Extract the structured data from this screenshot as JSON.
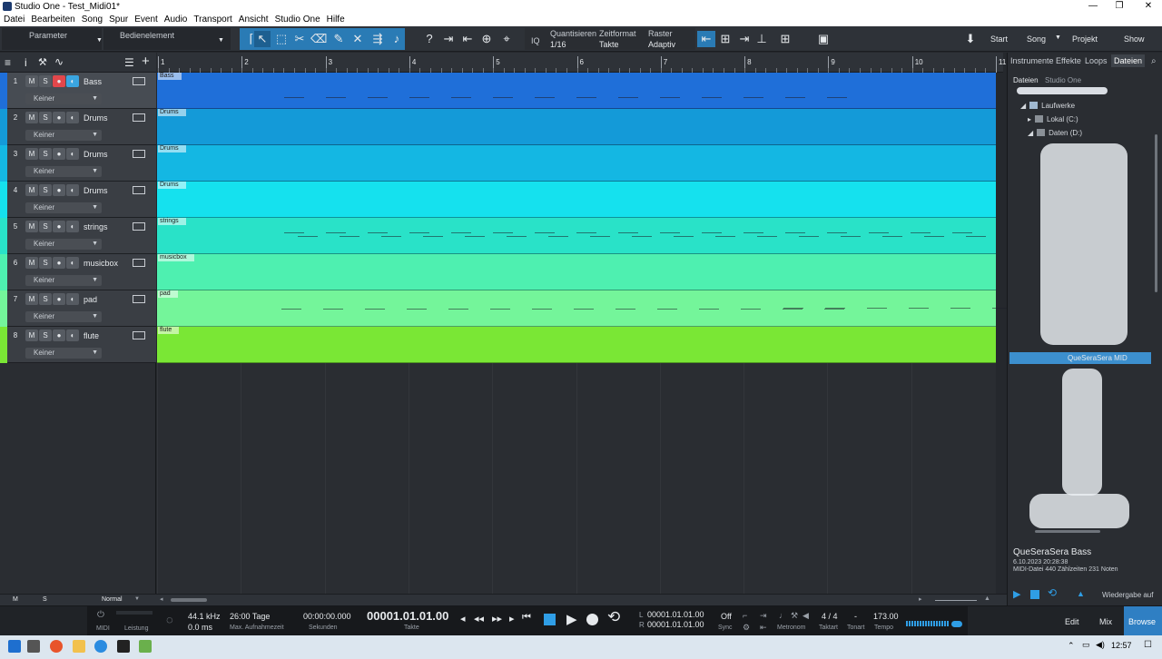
{
  "window": {
    "title": "Studio One - Test_Midi01*",
    "minimize": "—",
    "restore": "❐",
    "close": "✕"
  },
  "menu": [
    "Datei",
    "Bearbeiten",
    "Song",
    "Spur",
    "Event",
    "Audio",
    "Transport",
    "Ansicht",
    "Studio One",
    "Hilfe"
  ],
  "toolbar": {
    "parameter_label": "Parameter",
    "control_label": "Bedienelement",
    "iq_label": "IQ",
    "quantize_label": "Quantisieren",
    "quantize_value": "1/16",
    "timeformat_label": "Zeitformat",
    "timeformat_value": "Takte",
    "grid_label": "Raster",
    "grid_value": "Adaptiv",
    "start_label": "Start",
    "song_label": "Song",
    "project_label": "Projekt",
    "show_label": "Show"
  },
  "ruler": {
    "bars": [
      "1",
      "2",
      "3",
      "4",
      "5",
      "6",
      "7",
      "8",
      "9",
      "10",
      "11"
    ]
  },
  "tracks": [
    {
      "num": "1",
      "name": "Bass",
      "input": "Keiner",
      "color": "#1f6fd9",
      "armed": true,
      "m": "M",
      "s": "S"
    },
    {
      "num": "2",
      "name": "Drums",
      "input": "Keiner",
      "color": "#149ad8",
      "armed": false,
      "m": "M",
      "s": "S"
    },
    {
      "num": "3",
      "name": "Drums",
      "input": "Keiner",
      "color": "#14b7e3",
      "armed": false,
      "m": "M",
      "s": "S"
    },
    {
      "num": "4",
      "name": "Drums",
      "input": "Keiner",
      "color": "#15e1ee",
      "armed": false,
      "m": "M",
      "s": "S"
    },
    {
      "num": "5",
      "name": "strings",
      "input": "Keiner",
      "color": "#29e2c8",
      "armed": false,
      "m": "M",
      "s": "S"
    },
    {
      "num": "6",
      "name": "musicbox",
      "input": "Keiner",
      "color": "#4ef0b0",
      "armed": false,
      "m": "M",
      "s": "S"
    },
    {
      "num": "7",
      "name": "pad",
      "input": "Keiner",
      "color": "#74f59a",
      "armed": false,
      "m": "M",
      "s": "S"
    },
    {
      "num": "8",
      "name": "flute",
      "input": "Keiner",
      "color": "#7ae735",
      "armed": false,
      "m": "M",
      "s": "S"
    }
  ],
  "trackhead_bottom": {
    "m": "M",
    "s": "S",
    "mode": "Normal"
  },
  "browser": {
    "tabs": [
      "Instrumente",
      "Effekte",
      "Loops",
      "Dateien"
    ],
    "active_tab": "Dateien",
    "subtabs": [
      "Dateien",
      "Studio One"
    ],
    "tree": [
      {
        "label": "Laufwerke",
        "level": 0
      },
      {
        "label": "Lokal (C:)",
        "level": 1
      },
      {
        "label": "Daten (D:)",
        "level": 1
      }
    ],
    "selected_item": "QueSeraSera MID",
    "info": {
      "title": "QueSeraSera Bass",
      "date": "6.10.2023 20:28:38",
      "meta": "MIDI-Datei 440 Zählzeiten 231 Noten"
    },
    "playback_label": "Wiedergabe auf"
  },
  "transport": {
    "midi": "MIDI",
    "performance": "Leistung",
    "samplerate": "44.1 kHz",
    "latency": "0.0 ms",
    "rec_time": "26:00 Tage",
    "rec_time_label": "Max. Aufnahmezeit",
    "seconds": "00:00:00.000",
    "seconds_label": "Sekunden",
    "position": "00001.01.01.00",
    "position_label": "Takte",
    "loop_l": "00001.01.01.00",
    "loop_r": "00001.01.01.00",
    "l_label": "L",
    "r_label": "R",
    "sync": "Off",
    "sync_label": "Sync",
    "metronome_label": "Metronom",
    "time_sig": "4 / 4",
    "time_sig_label": "Taktart",
    "key": "-",
    "key_label": "Tonart",
    "tempo": "173.00",
    "tempo_label": "Tempo",
    "edit": "Edit",
    "mix": "Mix",
    "browse": "Browse"
  },
  "taskbar": {
    "time": "12:57"
  }
}
